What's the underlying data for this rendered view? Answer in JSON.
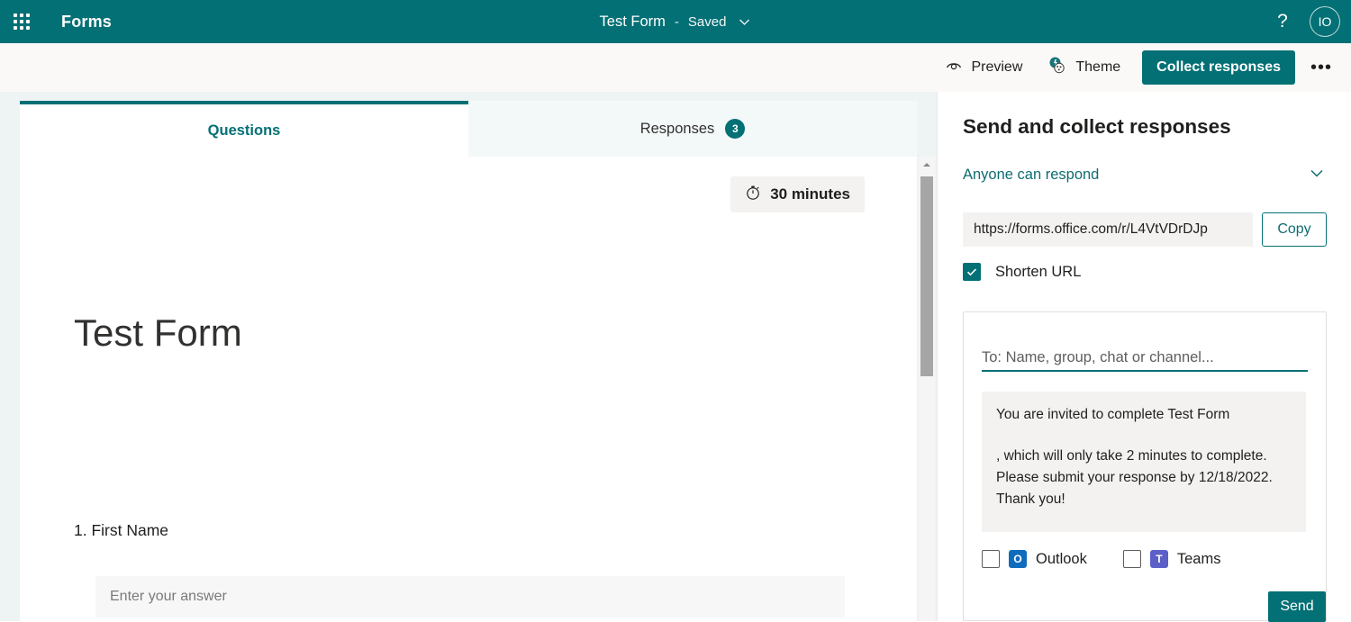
{
  "colors": {
    "brand_teal": "#037075",
    "link_teal": "#0f6c70",
    "canvas_gray": "#eef3f3",
    "field_gray": "#f3f2f1",
    "outlook_blue": "#0f6cbd",
    "teams_purple": "#5b5fc7"
  },
  "topbar": {
    "waffle_icon": "app-launcher-waffle-icon",
    "app_name": "Forms",
    "doc_title": "Test Form",
    "separator": "-",
    "save_state": "Saved",
    "chevron_icon": "chevron-down-icon",
    "help_icon": "?",
    "avatar_initials": "IO"
  },
  "commandbar": {
    "preview": {
      "label": "Preview",
      "icon": "eye-preview-icon"
    },
    "theme": {
      "label": "Theme",
      "icon": "paint-theme-icon"
    },
    "collect": {
      "label": "Collect responses"
    },
    "more": {
      "label": "•••",
      "icon": "more-options-icon"
    }
  },
  "tabs": [
    {
      "label": "Questions",
      "active": true,
      "badge": ""
    },
    {
      "label": "Responses",
      "active": false,
      "badge": "3"
    }
  ],
  "form": {
    "duration": {
      "icon": "timer-icon",
      "label": "30 minutes"
    },
    "title": "Test Form",
    "questions": [
      {
        "number": "1.",
        "label": "First Name",
        "answer_placeholder": "Enter your answer"
      }
    ]
  },
  "scrollbar": {
    "up_arrow_icon": "scroll-up-arrow-icon"
  },
  "panel": {
    "title": "Send and collect responses",
    "audience": {
      "label": "Anyone can respond",
      "chevron_icon": "chevron-down-icon"
    },
    "link": {
      "url": "https://forms.office.com/r/L4VtVDrDJp",
      "copy_label": "Copy"
    },
    "shorten_url": {
      "label": "Shorten URL",
      "checked": true,
      "check_glyph": "✓"
    },
    "invite": {
      "to_placeholder": "To: Name, group, chat or channel...",
      "message_line1": "You are invited to complete Test Form",
      "message_line2": ", which will only take 2 minutes to complete. Please submit your response by 12/18/2022. Thank you!",
      "channels": [
        {
          "label": "Outlook",
          "icon": "outlook-icon",
          "glyph": "O",
          "checked": false
        },
        {
          "label": "Teams",
          "icon": "teams-icon",
          "glyph": "T",
          "checked": false
        }
      ],
      "send_label": "Send"
    }
  }
}
